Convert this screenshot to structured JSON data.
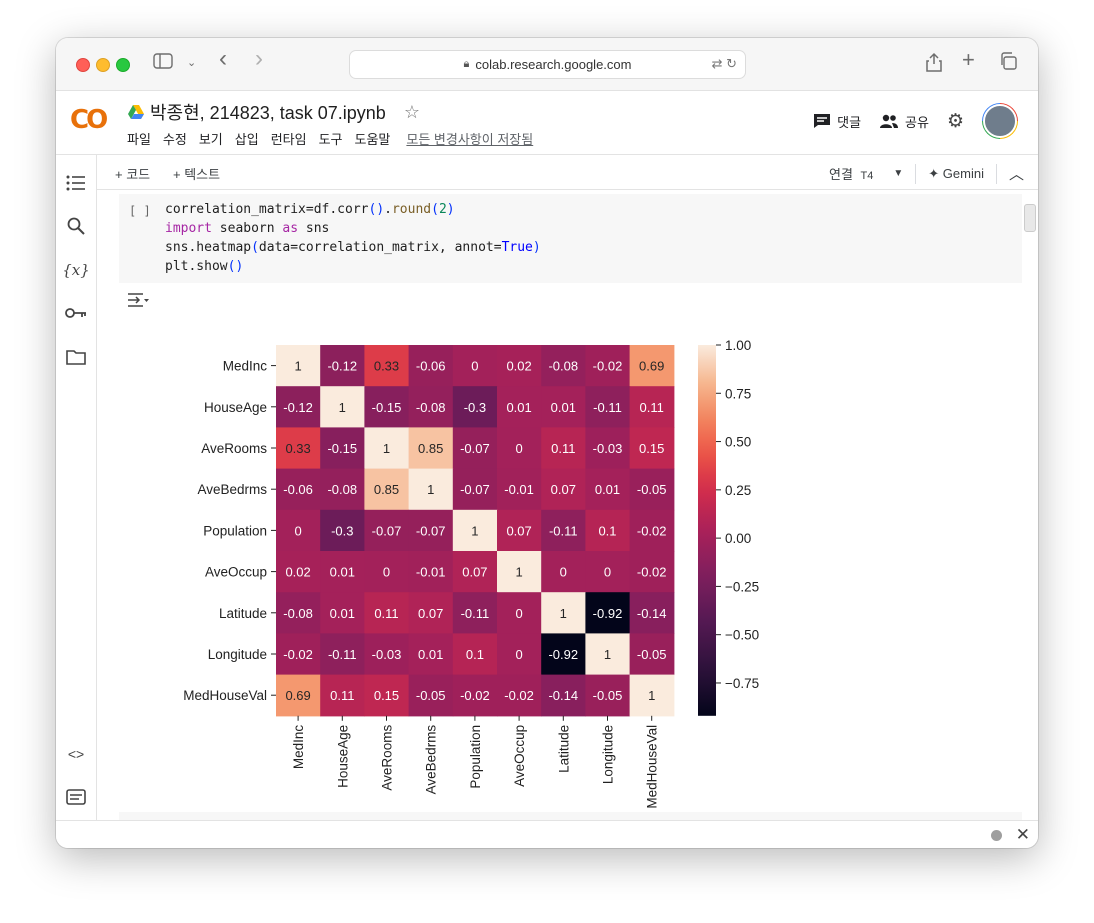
{
  "browser": {
    "url": "colab.research.google.com",
    "back": "‹",
    "forward": "›"
  },
  "header": {
    "logo": "CO",
    "title": "박종현, 214823, task 07.ipynb",
    "menu": [
      "파일",
      "수정",
      "보기",
      "삽입",
      "런타임",
      "도구",
      "도움말"
    ],
    "saved_status": "모든 변경사항이 저장됨",
    "comments_label": "댓글",
    "share_label": "공유"
  },
  "toolbar": {
    "add_code": "+ 코드",
    "add_text": "+ 텍스트",
    "connect_label": "연결",
    "runtime": "T4",
    "gemini_label": "✦ Gemini"
  },
  "cell": {
    "run_marker": "[ ]"
  },
  "colors": {
    "accent_orange": "#f9ab00",
    "code_bg": "#f7f7f7"
  },
  "chart_data": {
    "type": "heatmap",
    "labels": [
      "MedInc",
      "HouseAge",
      "AveRooms",
      "AveBedrms",
      "Population",
      "AveOccup",
      "Latitude",
      "Longitude",
      "MedHouseVal"
    ],
    "matrix": [
      [
        1,
        -0.12,
        0.33,
        -0.06,
        0,
        0.02,
        -0.08,
        -0.02,
        0.69
      ],
      [
        -0.12,
        1,
        -0.15,
        -0.08,
        -0.3,
        0.01,
        0.01,
        -0.11,
        0.11
      ],
      [
        0.33,
        -0.15,
        1,
        0.85,
        -0.07,
        0,
        0.11,
        -0.03,
        0.15
      ],
      [
        -0.06,
        -0.08,
        0.85,
        1,
        -0.07,
        -0.01,
        0.07,
        0.01,
        -0.05
      ],
      [
        0,
        -0.3,
        -0.07,
        -0.07,
        1,
        0.07,
        -0.11,
        0.1,
        -0.02
      ],
      [
        0.02,
        0.01,
        0,
        -0.01,
        0.07,
        1,
        0,
        0,
        -0.02
      ],
      [
        -0.08,
        0.01,
        0.11,
        0.07,
        -0.11,
        0,
        1,
        -0.92,
        -0.14
      ],
      [
        -0.02,
        -0.11,
        -0.03,
        0.01,
        0.1,
        0,
        -0.92,
        1,
        -0.05
      ],
      [
        0.69,
        0.11,
        0.15,
        -0.05,
        -0.02,
        -0.02,
        -0.14,
        -0.05,
        1
      ]
    ],
    "colorbar_ticks": [
      "1.00",
      "0.75",
      "0.50",
      "0.25",
      "0.00",
      "−0.25",
      "−0.50",
      "−0.75"
    ],
    "colorbar_tick_values": [
      1.0,
      0.75,
      0.5,
      0.25,
      0.0,
      -0.25,
      -0.5,
      -0.75
    ],
    "vmin": -0.92,
    "vmax": 1.0,
    "colormap": "rocket",
    "annotated": true
  }
}
